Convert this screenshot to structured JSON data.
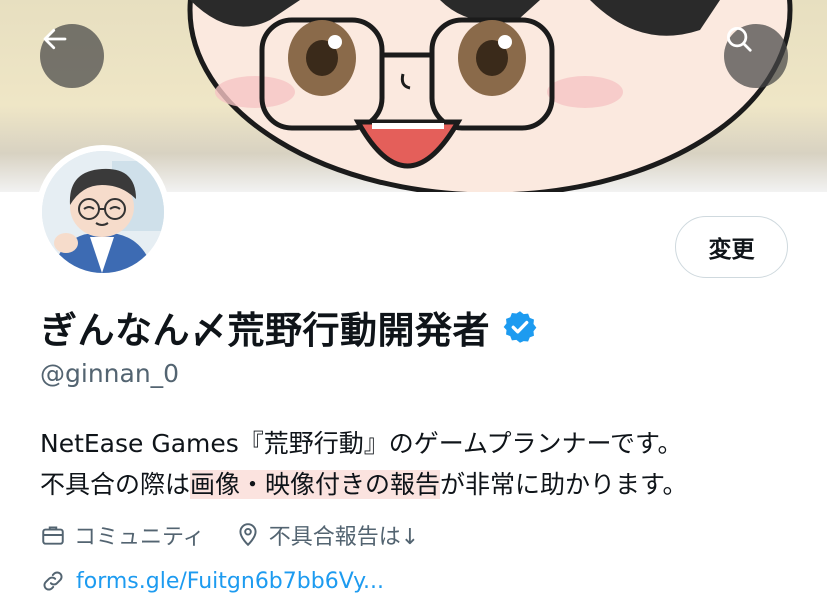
{
  "profile": {
    "display_name": "ぎんなん〆荒野行動開発者",
    "handle": "@ginnan_0",
    "bio_line1": "NetEase Games『荒野行動』のゲームプランナーです。",
    "bio_line2_pre": "不具合の際は",
    "bio_line2_highlight": "画像・映像付きの報告",
    "bio_line2_post": "が非常に助かります。",
    "category": "コミュニティ",
    "location": "不具合報告は↓",
    "link": "forms.gle/Fuitgn6b7bb6Vy..."
  },
  "actions": {
    "edit_label": "変更"
  },
  "icons": {
    "back": "arrow-left-icon",
    "search": "search-icon",
    "verified": "verified-badge-icon",
    "category": "briefcase-icon",
    "location": "location-pin-icon",
    "link": "link-icon"
  },
  "colors": {
    "accent": "#1d9bf0",
    "secondary_text": "#536471",
    "highlight": "#fbe3df"
  }
}
